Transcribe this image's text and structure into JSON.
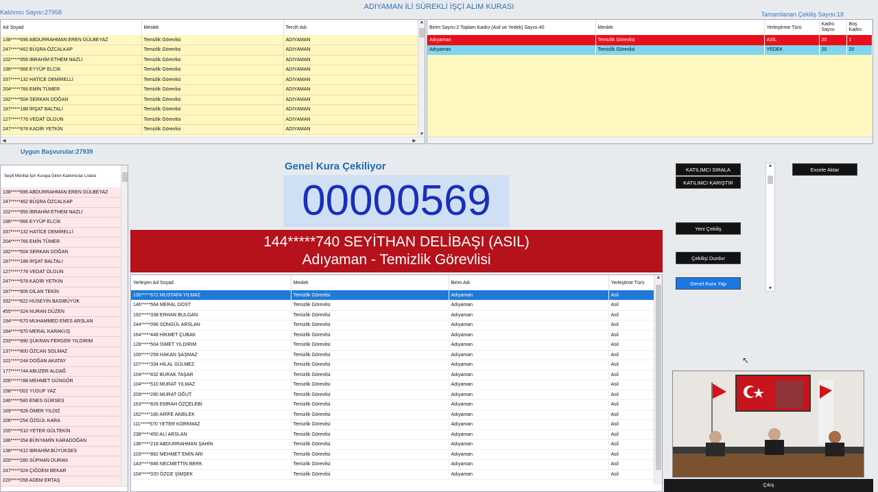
{
  "header": {
    "title": "ADIYAMAN İLİ SÜREKLİ İŞÇİ ALIM KURASI",
    "participants": "Katılımcı Sayısı:27958",
    "completed": "Tamamlanan Çekiliş Sayısı:18"
  },
  "applicants_table": {
    "columns": [
      "Ad Soyad",
      "Meslek",
      "Tercih Adı"
    ],
    "rows": [
      [
        "138*****696 ABDURRAHMAN EREN GÜLBEYAZ",
        "Temizlik Görevlisi",
        "ADIYAMAN"
      ],
      [
        "247*****462 BÜŞRA ÖZCALKAP",
        "Temizlik Görevlisi",
        "ADIYAMAN"
      ],
      [
        "102*****956 İBRAHİM ETHEM NAZLI",
        "Temizlik Görevlisi",
        "ADIYAMAN"
      ],
      [
        "196*****966 EYYÜP ELCİK",
        "Temizlik Görevlisi",
        "ADIYAMAN"
      ],
      [
        "337*****132 HATİCE DEMİRELLİ",
        "Temizlik Görevlisi",
        "ADIYAMAN"
      ],
      [
        "204*****766 EMİN TÜMER",
        "Temizlik Görevlisi",
        "ADIYAMAN"
      ],
      [
        "182*****504 SERKAN DOĞAN",
        "Temizlik Görevlisi",
        "ADIYAMAN"
      ],
      [
        "187*****188 İRŞAT BALTALI",
        "Temizlik Görevlisi",
        "ADIYAMAN"
      ],
      [
        "127*****776 VEDAT OLGUN",
        "Temizlik Görevlisi",
        "ADIYAMAN"
      ],
      [
        "247*****978 KADİR YETKİN",
        "Temizlik Görevlisi",
        "ADIYAMAN"
      ]
    ]
  },
  "unit_table": {
    "columns": [
      "Birim Sayısı:2 Toplam Kadro (Asil ve Yedek) Sayısı:40",
      "Meslek",
      "Yerleştirme Türü",
      "Kadro Sayısı",
      "Boş Kadro"
    ],
    "rows": [
      [
        "Adıyaman",
        "Temizlik Görevlisi",
        "ASİL",
        "20",
        "1"
      ],
      [
        "Adıyaman",
        "Temizlik Görevlisi",
        "YEDEK",
        "20",
        "20"
      ]
    ]
  },
  "eligible": {
    "label": "Uygun Başvurular:27939",
    "list_title": "Seçili Münhal İçin Kuraya Giren Katılımcılar Listesi",
    "rows": [
      "138*****696 ABDURRAHMAN EREN GÜLBEYAZ",
      "247*****462 BÜŞRA ÖZCALKAP",
      "102*****956 İBRAHİM ETHEM NAZLI",
      "196*****966 EYYÜP ELCİK",
      "337*****132 HATİCE DEMİRELLİ",
      "204*****766 EMİN TÜMER",
      "182*****504 SERKAN DOĞAN",
      "187*****188 İRŞAT BALTALI",
      "127*****776 VEDAT OLGUN",
      "247*****978 KADİR YETKİN",
      "187*****906 DİLAN TEKİN",
      "332*****822 HÜSEYİN BASIBÜYÜK",
      "455*****324 NURAN DÜZEN",
      "194*****670 MUHAMMED ENES ARSLAN",
      "184*****970 MERAL KARAKUŞ",
      "233*****990 ŞÜKRAN FERGER YILDIRIM",
      "137*****800 ÖZCAN SOLMAZ",
      "101*****244 DOĞAN AKATAY",
      "177*****744 ABUZER ALDAĞ",
      "206*****788 MEHMET GÜNGÖR",
      "158*****002 YUSUF YAZ",
      "246*****580 ENES GÜRSES",
      "169*****928 ÖMER YILDIZ",
      "206*****254 ÖZGÜL KARA",
      "155*****510 YETER GÜLTEKİN",
      "186*****354 BÜNYAMİN KARADOĞAN",
      "138*****412 İBRAHİM BÜYÜKSES",
      "200*****280 SÜPHAN DURAN",
      "247*****324 ÇİĞDEM BEKAR",
      "220*****058 ADEM ERTAŞ"
    ]
  },
  "draw": {
    "status": "Genel Kura Çekiliyor",
    "number": "00000569",
    "winner_line1": "144*****740 SEYİTHAN DELİBAŞI (ASIL)",
    "winner_line2": "Adıyaman - Temizlik Görevlisi"
  },
  "placed_table": {
    "columns": [
      "Yerleşen Ad Soyad",
      "Meslek",
      "Birim Adı",
      "Yerleştime Türü"
    ],
    "rows": [
      [
        "130*****672 MUSTAFA YILMAZ",
        "Temizlik Görevlisi",
        "Adıyaman",
        "Asil"
      ],
      [
        "146*****564 MERAL DOST",
        "Temizlik Görevlisi",
        "Adıyaman",
        "Asil"
      ],
      [
        "192*****338 ERHAN BULGAN",
        "Temizlik Görevlisi",
        "Adıyaman",
        "Asil"
      ],
      [
        "244*****096 SONGÜL ARSLAN",
        "Temizlik Görevlisi",
        "Adıyaman",
        "Asil"
      ],
      [
        "164*****448 HİKMET ÇUBAK",
        "Temizlik Görevlisi",
        "Adıyaman",
        "Asil"
      ],
      [
        "128*****504 İSMET YILDIRIM",
        "Temizlik Görevlisi",
        "Adıyaman",
        "Asil"
      ],
      [
        "100*****258 HAKAN ŞAŞMAZ",
        "Temizlik Görevlisi",
        "Adıyaman",
        "Asil"
      ],
      [
        "107*****334 HİLAL GÜLMEZ",
        "Temizlik Görevlisi",
        "Adıyaman",
        "Asil"
      ],
      [
        "104*****832 BURAK TAŞAR",
        "Temizlik Görevlisi",
        "Adıyaman",
        "Asil"
      ],
      [
        "104*****510 MURAT YILMAZ",
        "Temizlik Görevlisi",
        "Adıyaman",
        "Asil"
      ],
      [
        "209*****280 MURAT OĞUT",
        "Temizlik Görevlisi",
        "Adıyaman",
        "Asil"
      ],
      [
        "163*****826 EMRAH ÖZÇELEBİ",
        "Temizlik Görevlisi",
        "Adıyaman",
        "Asil"
      ],
      [
        "162*****180 ARİFE AKBİLEK",
        "Temizlik Görevlisi",
        "Adıyaman",
        "Asil"
      ],
      [
        "111*****570 YETER KORKMAZ",
        "Temizlik Görevlisi",
        "Adıyaman",
        "Asil"
      ],
      [
        "238*****450 ALİ ARSLAN",
        "Temizlik Görevlisi",
        "Adıyaman",
        "Asil"
      ],
      [
        "136*****218 ABDURRAHMAN ŞAHİN",
        "Temizlik Görevlisi",
        "Adıyaman",
        "Asil"
      ],
      [
        "103*****882 MEHMET EMİN ARI",
        "Temizlik Görevlisi",
        "Adıyaman",
        "Asil"
      ],
      [
        "143*****846 NECMETTİN BERK",
        "Temizlik Görevlisi",
        "Adıyaman",
        "Asil"
      ],
      [
        "104*****020 ÖZGE ŞİMŞEK",
        "Temizlik Görevlisi",
        "Adıyaman",
        "Asil"
      ]
    ]
  },
  "buttons": {
    "sort": "KATILIMCI SIRALA",
    "shuffle": "KATILIMCI KARIŞTIR",
    "excel": "Excele Aktar",
    "new_draw": "Yeni Çekiliş",
    "stop": "Çekilişi Durdur",
    "general": "Genel Kura Yap",
    "exit": "Çıkış"
  },
  "colors": {
    "accent_blue": "#2f6fb5",
    "banner_red": "#b5121b",
    "row_yellow": "#fff7c0",
    "row_pink": "#fde8ea",
    "selected_blue": "#1e7ad8"
  }
}
